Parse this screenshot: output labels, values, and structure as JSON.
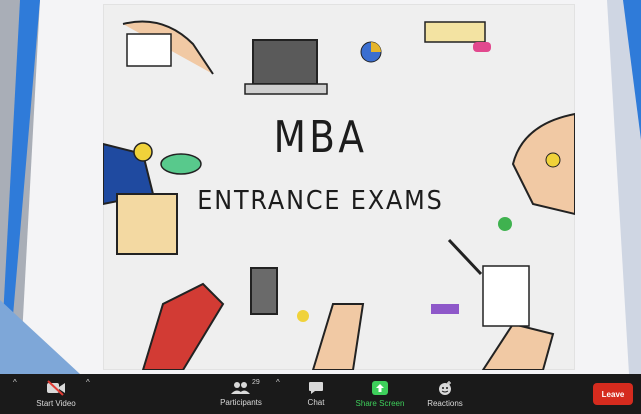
{
  "slide": {
    "title_line1": "MBA",
    "title_line2": "ENTRANCE EXAMS"
  },
  "toolbar": {
    "start_video_label": "Start Video",
    "participants_label": "Participants",
    "participants_count": "29",
    "chat_label": "Chat",
    "share_screen_label": "Share Screen",
    "reactions_label": "Reactions",
    "leave_label": "Leave",
    "caret_glyph": "^"
  },
  "colors": {
    "toolbar_bg": "#1a1a1a",
    "share_green": "#3ecf5b",
    "leave_red": "#d52b1e",
    "accent_blue": "#2f7bd9"
  },
  "icons": [
    "video-off-icon",
    "participants-icon",
    "chat-icon",
    "share-screen-icon",
    "reactions-icon"
  ]
}
